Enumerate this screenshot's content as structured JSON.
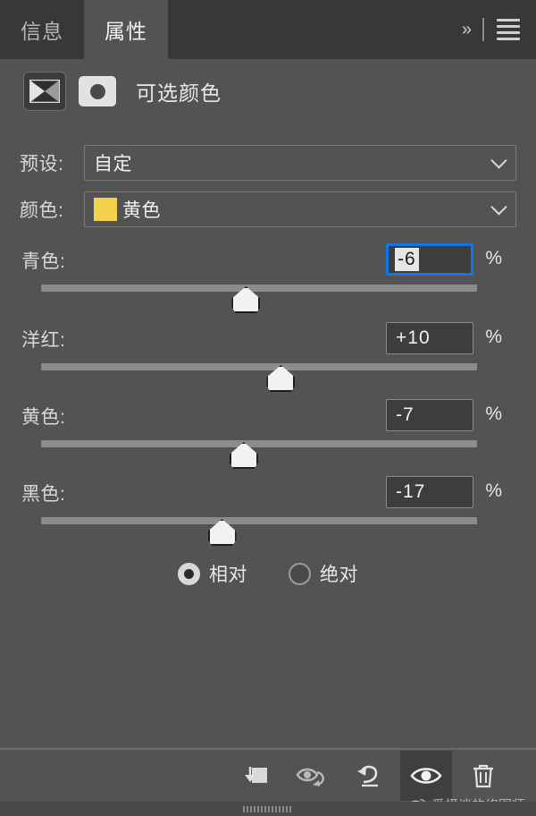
{
  "panel": {
    "tabs": [
      {
        "label": "信息",
        "active": false,
        "name": "tab-info"
      },
      {
        "label": "属性",
        "active": true,
        "name": "tab-properties"
      }
    ],
    "expand_icon": "double-chevron-right-icon",
    "menu_icon": "hamburger-menu-icon"
  },
  "header": {
    "adjustment_icon": "selective-color-adjustment-icon",
    "mask_icon": "layer-mask-icon",
    "title": "可选颜色"
  },
  "preset": {
    "label": "预设:",
    "value": "自定",
    "caret_icon": "chevron-down-icon"
  },
  "color": {
    "label": "颜色:",
    "value": "黄色",
    "swatch_hex": "#f5d24e",
    "caret_icon": "chevron-down-icon"
  },
  "sliders": [
    {
      "label": "青色:",
      "value": "-6",
      "unit": "%",
      "percent": -6,
      "focused": true,
      "name": "cyan"
    },
    {
      "label": "洋红:",
      "value": "+10",
      "unit": "%",
      "percent": 10,
      "focused": false,
      "name": "magenta"
    },
    {
      "label": "黄色:",
      "value": "-7",
      "unit": "%",
      "percent": -7,
      "focused": false,
      "name": "yellow"
    },
    {
      "label": "黑色:",
      "value": "-17",
      "unit": "%",
      "percent": -17,
      "focused": false,
      "name": "black"
    }
  ],
  "method": {
    "options": [
      {
        "label": "相对",
        "selected": true
      },
      {
        "label": "绝对",
        "selected": false
      }
    ]
  },
  "toolbar": {
    "buttons": [
      {
        "name": "clip-to-layer-icon",
        "active": false
      },
      {
        "name": "toggle-preview-icon",
        "active": false
      },
      {
        "name": "reset-icon",
        "active": false
      },
      {
        "name": "visibility-eye-icon",
        "active": true
      },
      {
        "name": "delete-trash-icon",
        "active": false
      }
    ]
  },
  "watermark": {
    "logo": "weibo-logo-icon",
    "text": "爱怪谈的修图师"
  },
  "colors": {
    "panel_bg": "#535353",
    "tabbar_bg": "#383838",
    "focus_border": "#1473e6",
    "track": "#8c8c8c"
  }
}
